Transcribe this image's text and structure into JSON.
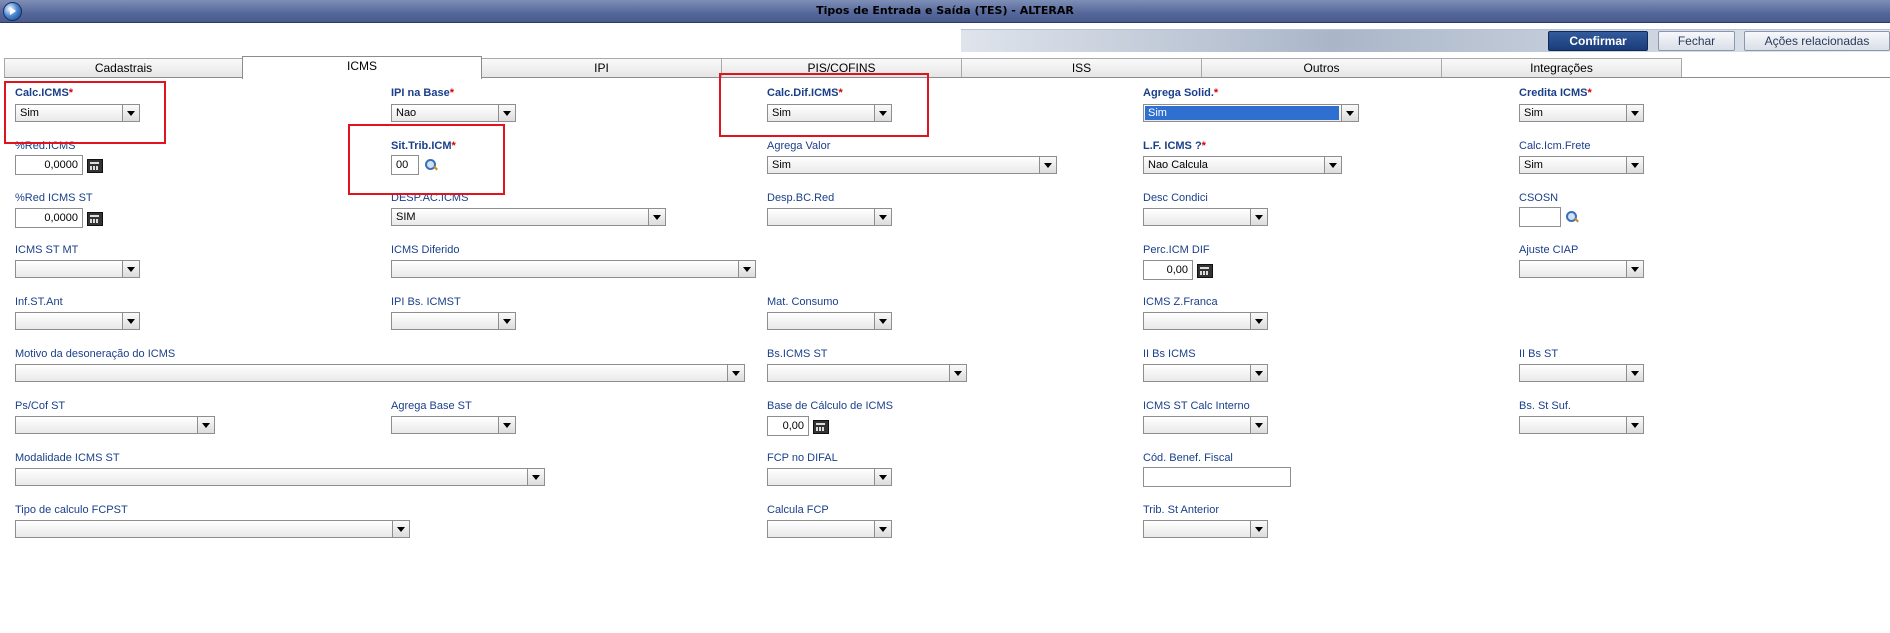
{
  "window": {
    "title": "Tipos de Entrada e Saída (TES) - ALTERAR"
  },
  "actions": {
    "confirm": "Confirmar",
    "close": "Fechar",
    "related": "Ações relacionadas"
  },
  "tabs": [
    "Cadastrais",
    "ICMS",
    "IPI",
    "PIS/COFINS",
    "ISS",
    "Outros",
    "Integrações"
  ],
  "active_tab": "ICMS",
  "colors": {
    "title_bar": "#55679a",
    "label": "#1a3f8a",
    "required_star": "#d80000",
    "highlight_box": "#e0141e",
    "selection": "#2f6fd0"
  },
  "fields": {
    "calc_icms": {
      "label": "Calc.ICMS",
      "value": "Sim"
    },
    "ipi_na_base": {
      "label": "IPI na Base",
      "value": "Nao"
    },
    "calc_dif_icms": {
      "label": "Calc.Dif.ICMS",
      "value": "Sim"
    },
    "agrega_solid": {
      "label": "Agrega Solid.",
      "value": "Sim"
    },
    "credita_icms": {
      "label": "Credita ICMS",
      "value": "Sim"
    },
    "red_icms": {
      "label": "%Red.ICMS",
      "value": "0,0000"
    },
    "sit_trib_icm": {
      "label": "Sit.Trib.ICM",
      "value": "00"
    },
    "agrega_valor": {
      "label": "Agrega Valor",
      "value": "Sim"
    },
    "lf_icms": {
      "label": "L.F. ICMS ?",
      "value": "Nao Calcula"
    },
    "calc_icm_frete": {
      "label": "Calc.Icm.Frete",
      "value": "Sim"
    },
    "red_icms_st": {
      "label": "%Red ICMS ST",
      "value": "0,0000"
    },
    "desp_ac_icms": {
      "label": "DESP.AC.ICMS",
      "value": "SIM"
    },
    "desp_bc_red": {
      "label": "Desp.BC.Red",
      "value": ""
    },
    "desc_condici": {
      "label": "Desc Condici",
      "value": ""
    },
    "csosn": {
      "label": "CSOSN",
      "value": ""
    },
    "icms_st_mt": {
      "label": "ICMS ST MT",
      "value": ""
    },
    "icms_diferido": {
      "label": "ICMS Diferido",
      "value": ""
    },
    "perc_icm_dif": {
      "label": "Perc.ICM DIF",
      "value": "0,00"
    },
    "ajuste_ciap": {
      "label": "Ajuste CIAP",
      "value": ""
    },
    "inf_st_ant": {
      "label": "Inf.ST.Ant",
      "value": ""
    },
    "ipi_bs_icmst": {
      "label": "IPI Bs. ICMST",
      "value": ""
    },
    "mat_consumo": {
      "label": "Mat. Consumo",
      "value": ""
    },
    "icms_z_franca": {
      "label": "ICMS Z.Franca",
      "value": ""
    },
    "motivo_deson": {
      "label": "Motivo da desoneração do ICMS",
      "value": ""
    },
    "bs_icms_st": {
      "label": "Bs.ICMS ST",
      "value": ""
    },
    "ii_bs_icms": {
      "label": "II Bs ICMS",
      "value": ""
    },
    "ii_bs_st": {
      "label": "II Bs ST",
      "value": ""
    },
    "ps_cof_st": {
      "label": "Ps/Cof ST",
      "value": ""
    },
    "agrega_base_st": {
      "label": "Agrega Base ST",
      "value": ""
    },
    "base_calc_icms": {
      "label": "Base de Cálculo de ICMS",
      "value": "0,00"
    },
    "icms_st_calc_interno": {
      "label": "ICMS ST Calc Interno",
      "value": ""
    },
    "bs_st_suf": {
      "label": "Bs. St Suf.",
      "value": ""
    },
    "modalidade_icms_st": {
      "label": "Modalidade ICMS ST",
      "value": ""
    },
    "fcp_no_difal": {
      "label": "FCP no DIFAL",
      "value": ""
    },
    "cod_benef_fiscal": {
      "label": "Cód. Benef. Fiscal",
      "value": ""
    },
    "tipo_calculo_fcpst": {
      "label": "Tipo de calculo FCPST",
      "value": ""
    },
    "calcula_fcp": {
      "label": "Calcula FCP",
      "value": ""
    },
    "trib_st_anterior": {
      "label": "Trib. St Anterior",
      "value": ""
    }
  },
  "required_star": "*",
  "icons": {
    "calculator": "calculator-icon",
    "search": "magnifier-icon",
    "app": "app-logo-icon"
  }
}
